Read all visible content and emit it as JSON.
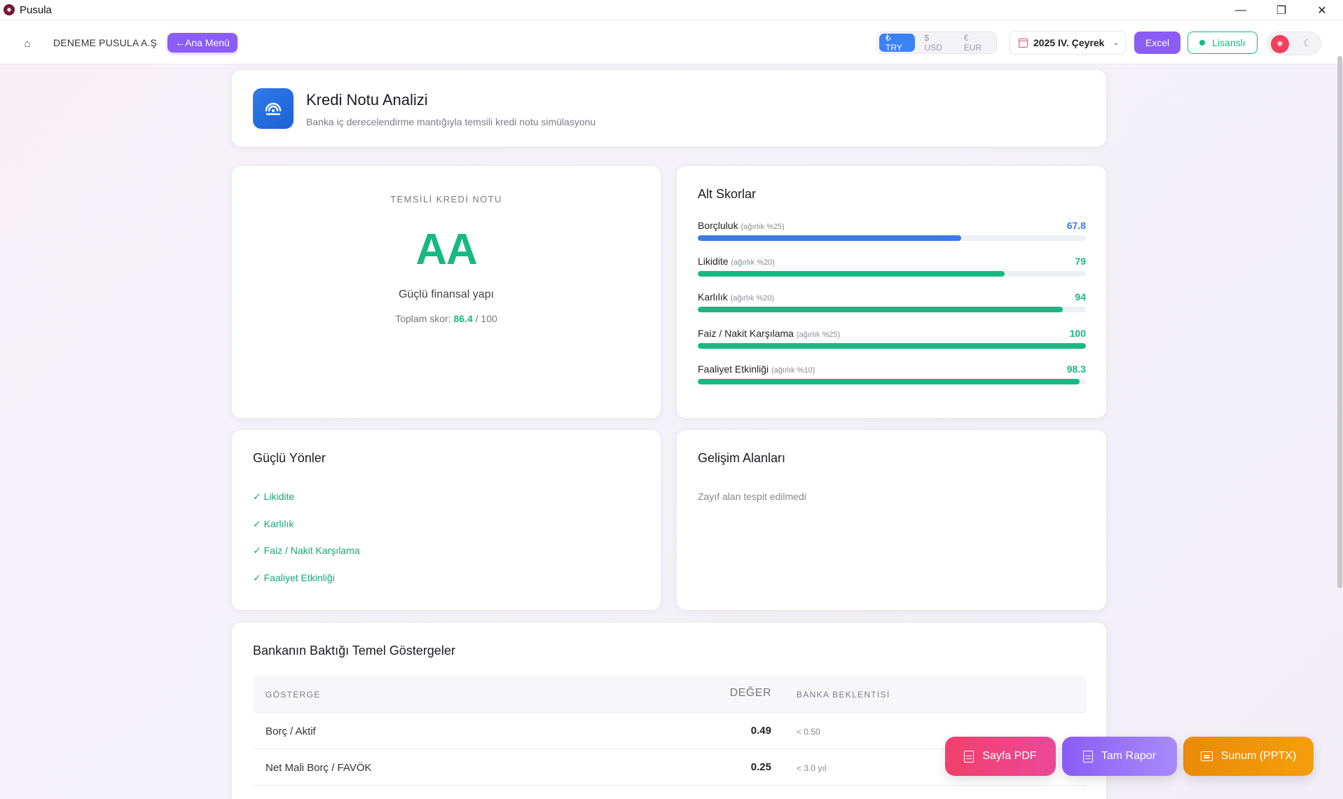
{
  "window": {
    "title": "Pusula"
  },
  "topbar": {
    "company": "DENEME PUSULA A.Ş",
    "main_menu": "←Ana Menü",
    "currencies": [
      "₺ TRY",
      "$ USD",
      "€ EUR"
    ],
    "active_currency": "₺ TRY",
    "period": "2025 IV. Çeyrek",
    "excel": "Excel",
    "license": "Lisanslı"
  },
  "header": {
    "title": "Kredi Notu Analizi",
    "subtitle": "Banka iç derecelendirme mantığıyla temsili kredi notu simülasyonu"
  },
  "rating": {
    "label": "TEMSİLİ KREDİ NOTU",
    "grade": "AA",
    "description": "Güçlü finansal yapı",
    "total_prefix": "Toplam skor: ",
    "total_score": "86.4",
    "total_suffix": " / 100"
  },
  "sub_scores": {
    "title": "Alt Skorlar",
    "items": [
      {
        "name": "Borçluluk",
        "weight": "(ağırlık %25)",
        "value": "67.8",
        "percent": 67.8,
        "color": "#3b7ddd"
      },
      {
        "name": "Likidite",
        "weight": "(ağırlık %20)",
        "value": "79",
        "percent": 79,
        "color": "#16b981"
      },
      {
        "name": "Karlılık",
        "weight": "(ağırlık %20)",
        "value": "94",
        "percent": 94,
        "color": "#16b981"
      },
      {
        "name": "Faiz / Nakit Karşılama",
        "weight": "(ağırlık %25)",
        "value": "100",
        "percent": 100,
        "color": "#16b981"
      },
      {
        "name": "Faaliyet Etkinliği",
        "weight": "(ağırlık %10)",
        "value": "98.3",
        "percent": 98.3,
        "color": "#16b981"
      }
    ]
  },
  "strengths": {
    "title": "Güçlü Yönler",
    "items": [
      "✓ Likidite",
      "✓ Karlılık",
      "✓ Faiz / Nakit Karşılama",
      "✓ Faaliyet Etkinliği"
    ]
  },
  "improvements": {
    "title": "Gelişim Alanları",
    "empty_text": "Zayıf alan tespit edilmedi"
  },
  "indicators": {
    "title": "Bankanın Baktığı Temel Göstergeler",
    "columns": [
      "GÖSTERGE",
      "DEĞER",
      "BANKA BEKLENTİSİ"
    ],
    "rows": [
      {
        "name": "Borç / Aktif",
        "value": "0.49",
        "expectation": "< 0.50"
      },
      {
        "name": "Net Mali Borç / FAVÖK",
        "value": "0.25",
        "expectation": "< 3.0 yıl"
      }
    ]
  },
  "actions": {
    "pdf": "Sayfa PDF",
    "report": "Tam Rapor",
    "pptx": "Sunum (PPTX)"
  }
}
